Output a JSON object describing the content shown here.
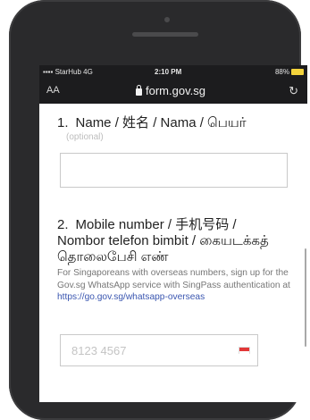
{
  "status_bar": {
    "carrier": "StarHub  4G",
    "time": "2:10 PM",
    "battery": "88%"
  },
  "browser": {
    "text_size_label": "AA",
    "url": "form.gov.sg",
    "reload_icon": "reload-icon"
  },
  "form": {
    "q1": {
      "number": "1.",
      "label": "Name / 姓名 / Nama / பெயர்",
      "optional": "(optional)",
      "value": ""
    },
    "q2": {
      "number": "2.",
      "label_line1": "Mobile number / 手机号码 /",
      "label_line2": "Nombor telefon bimbit / கையடக்கத்",
      "label_line3": "தொலைபேசி எண்",
      "help_text": "For Singaporeans with overseas numbers, sign up for the Gov.sg WhatsApp service with SingPass authentication at",
      "help_link": "https://go.gov.sg/whatsapp-overseas",
      "placeholder": "8123 4567",
      "country_flag": "singapore-flag"
    }
  },
  "colors": {
    "link": "#3a56b0",
    "browser_bar": "#1c1c1e",
    "battery": "#f3d33c"
  }
}
